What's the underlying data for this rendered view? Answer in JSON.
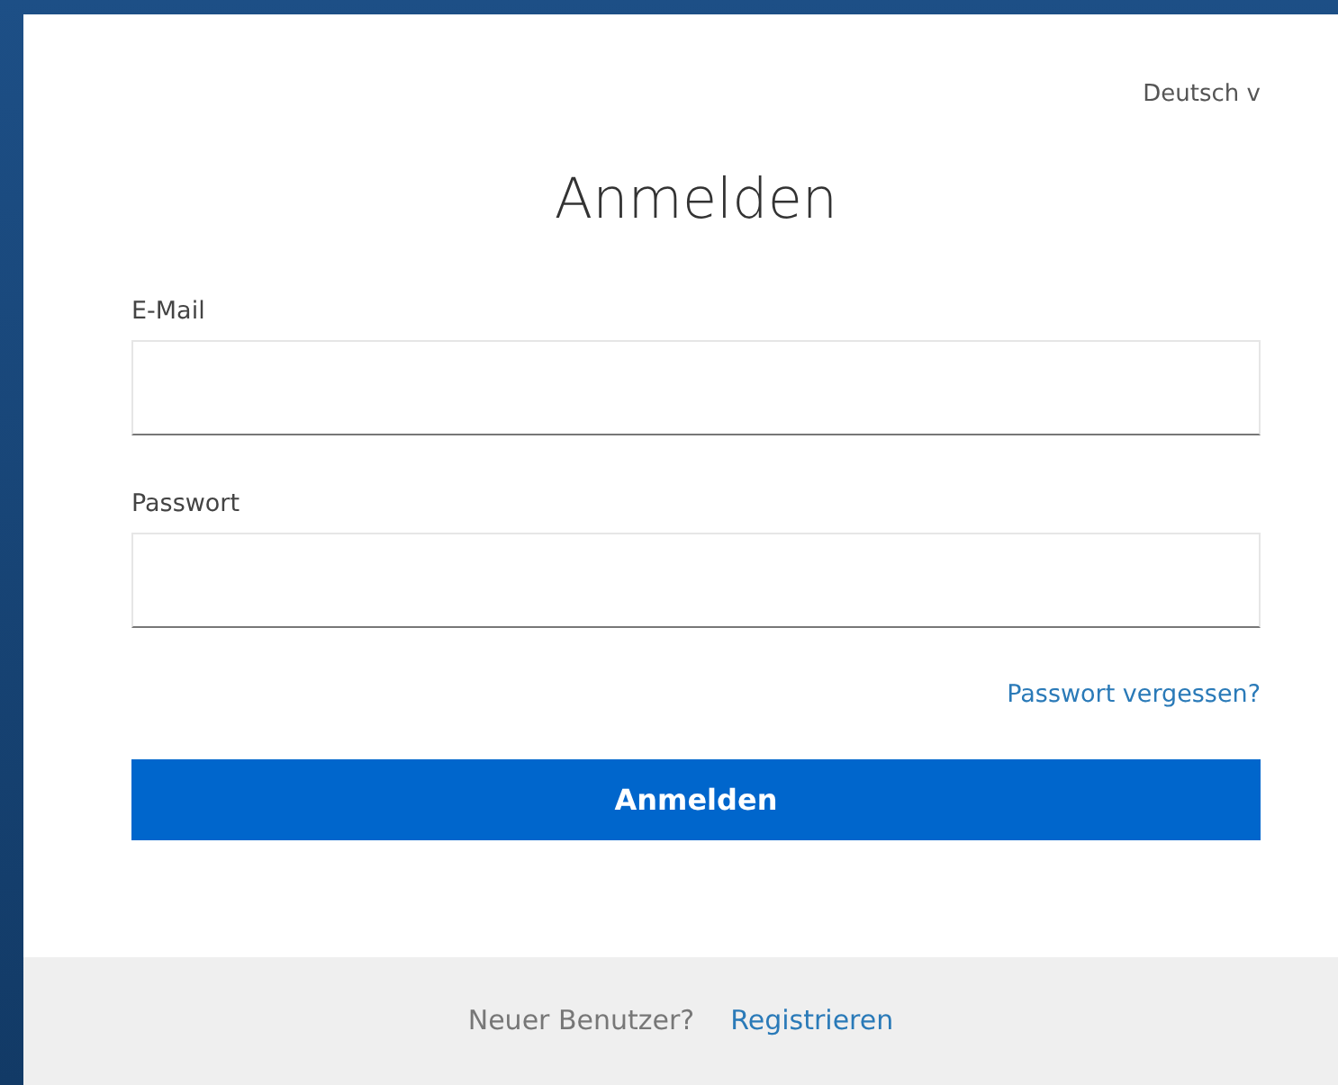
{
  "language_selector": {
    "label": "Deutsch v"
  },
  "title": "Anmelden",
  "fields": [
    {
      "label": "E-Mail"
    },
    {
      "label": "Passwort"
    }
  ],
  "forgot_link": "Passwort vergessen?",
  "submit_button": "Anmelden",
  "footer": {
    "text": "Neuer Benutzer?",
    "link": "Registrieren"
  }
}
